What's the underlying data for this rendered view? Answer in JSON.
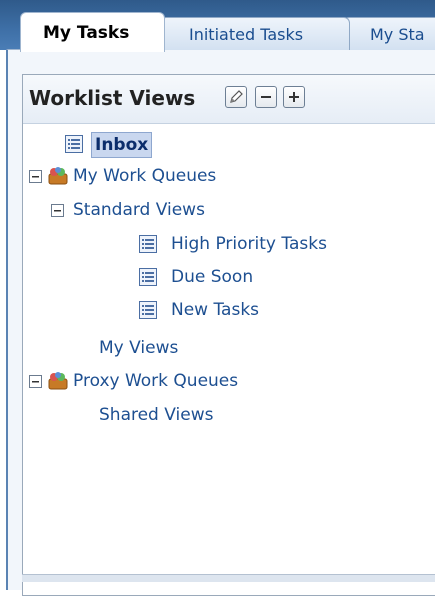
{
  "tabs": [
    {
      "label": "My Tasks",
      "active": true
    },
    {
      "label": "Initiated Tasks",
      "active": false
    },
    {
      "label": "My Sta",
      "active": false
    }
  ],
  "worklist": {
    "title": "Worklist Views",
    "buttons": [
      "edit-icon",
      "collapse-icon",
      "add-icon"
    ]
  },
  "tree": {
    "inbox": "Inbox",
    "my_work_queues": "My Work Queues",
    "standard_views": "Standard Views",
    "high_priority": "High Priority Tasks",
    "due_soon": "Due Soon",
    "new_tasks": "New Tasks",
    "my_views": "My Views",
    "proxy_work_queues": "Proxy Work Queues",
    "shared_views": "Shared Views"
  },
  "colors": {
    "tab_bar": "#3d6ea5",
    "link_text": "#1d4f91",
    "selected_bg": "#c9d7ef"
  }
}
